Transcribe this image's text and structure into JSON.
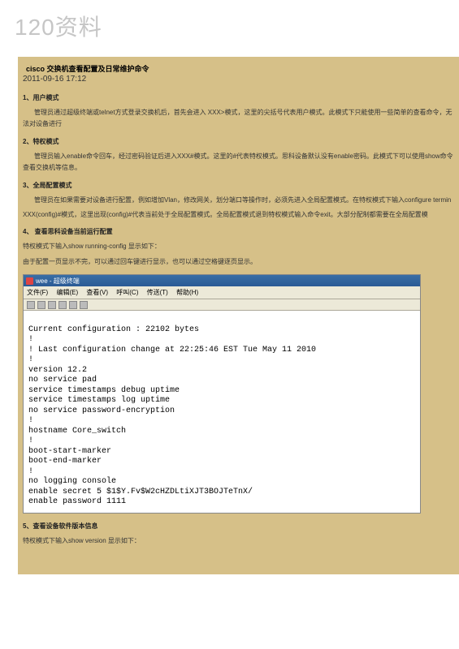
{
  "watermark": "120资料",
  "article": {
    "title": "cisco 交换机查看配置及日常维护命令",
    "date": "2011-09-16 17:12",
    "s1": {
      "head": "1、用户模式",
      "p": "管理员通过超级终端或telnet方式登录交换机后，首先会进入 XXX>模式，这里的尖括号代表用户模式。此模式下只能使用一些简单的查看命令，无法对设备进行"
    },
    "s2": {
      "head": "2、特权模式",
      "p": "管理员输入enable命令回车，经过密码验证后进入XXX#模式。这里的#代表特权模式。思科设备默认没有enable密码。此模式下可以使用show命令查看交换机等信息。"
    },
    "s3": {
      "head": "3、全局配置模式",
      "p1": "管理员在如果需要对设备进行配置，例如增加Vlan，修改网关，划分端口等操作时，必须先进入全局配置模式。在特权模式下输入configure termin",
      "p2": "XXX(config)#模式，这里出现(config)#代表当前处于全局配置模式。全局配置模式退到特权模式输入命令exit。大部分配制都需要在全局配置模"
    },
    "s4": {
      "head": "4、   查看思科设备当前运行配置",
      "p1": "特权模式下输入show running-config 显示如下：",
      "p2": "由于配置一页显示不完，可以通过回车键进行显示，也可以通过空格键逐页显示。"
    },
    "s5": {
      "head": "5、查看设备软件版本信息",
      "p": "特权模式下输入show version 显示如下："
    }
  },
  "terminal": {
    "windowTitle": "wee - 超级终端",
    "menu": {
      "file": "文件(F)",
      "edit": "编辑(E)",
      "view": "查看(V)",
      "call": "呼叫(C)",
      "transfer": "传送(T)",
      "help": "帮助(H)"
    },
    "body": "\nCurrent configuration : 22102 bytes\n!\n! Last configuration change at 22:25:46 EST Tue May 11 2010\n!\nversion 12.2\nno service pad\nservice timestamps debug uptime\nservice timestamps log uptime\nno service password-encryption\n!\nhostname Core_switch\n!\nboot-start-marker\nboot-end-marker\n!\nno logging console\nenable secret 5 $1$Y.Fv$W2cHZDLtiXJT3BOJTeTnX/\nenable password 1111"
  }
}
